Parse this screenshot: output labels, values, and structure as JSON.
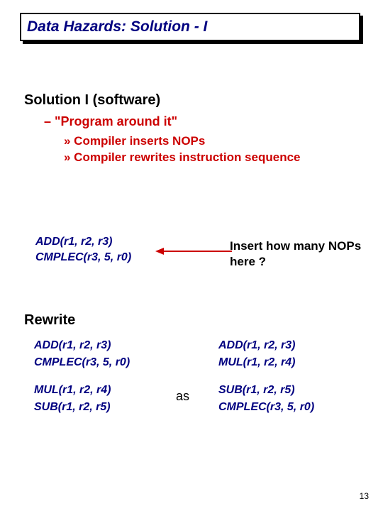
{
  "title": "Data Hazards: Solution - I",
  "heading": "Solution I (software)",
  "sub1": "– \"Program around it\"",
  "sub2a": "» Compiler inserts NOPs",
  "sub2b": "» Compiler rewrites instruction sequence",
  "code1": "ADD(r1, r2, r3)",
  "code2": "CMPLEC(r3, 5, r0)",
  "question": "Insert how many NOPs here ?",
  "rewrite_heading": "Rewrite",
  "as_label": "as",
  "left": {
    "l1": "ADD(r1, r2, r3)",
    "l2": "CMPLEC(r3, 5, r0)",
    "l3": "MUL(r1, r2, r4)",
    "l4": "SUB(r1, r2, r5)"
  },
  "right": {
    "l1": "ADD(r1, r2, r3)",
    "l2": "MUL(r1, r2, r4)",
    "l3": "SUB(r1, r2, r5)",
    "l4": "CMPLEC(r3, 5, r0)"
  },
  "page_number": "13"
}
